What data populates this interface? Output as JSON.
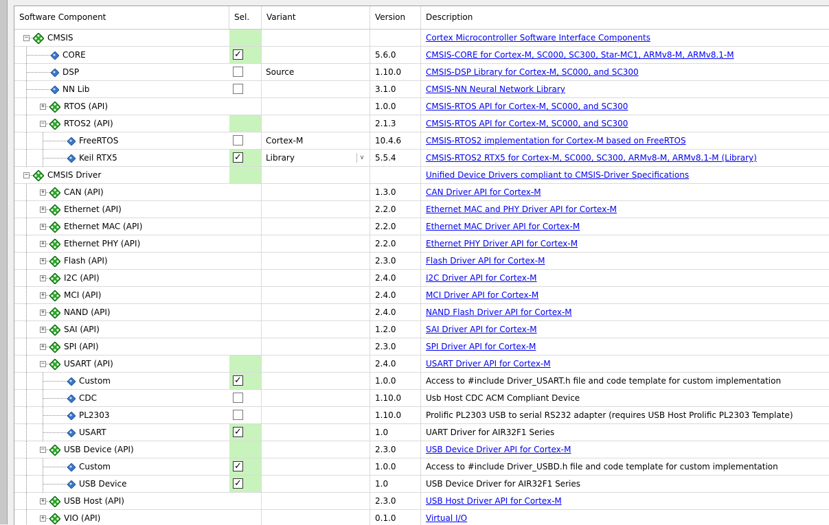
{
  "headers": {
    "component": "Software Component",
    "sel": "Sel.",
    "variant": "Variant",
    "version": "Version",
    "description": "Description"
  },
  "colors": {
    "selected_green": "#c9f3bd",
    "link": "#0000ee",
    "diamond_green": "#2aa52a"
  },
  "rows": [
    {
      "name": "CMSIS",
      "type": "group",
      "level": 0,
      "expander": "minus",
      "sel": "green",
      "variant": "",
      "version": "",
      "desc": "Cortex Microcontroller Software Interface Components",
      "link": true
    },
    {
      "name": "CORE",
      "type": "leaf",
      "level": 1,
      "sel": "checked",
      "variant": "",
      "version": "5.6.0",
      "desc": "CMSIS-CORE for Cortex-M, SC000, SC300, Star-MC1, ARMv8-M, ARMv8.1-M",
      "link": true
    },
    {
      "name": "DSP",
      "type": "leaf",
      "level": 1,
      "sel": "unchecked",
      "variant": "Source",
      "version": "1.10.0",
      "desc": "CMSIS-DSP Library for Cortex-M, SC000, and SC300",
      "link": true
    },
    {
      "name": "NN Lib",
      "type": "leaf",
      "level": 1,
      "sel": "unchecked",
      "variant": "",
      "version": "3.1.0",
      "desc": "CMSIS-NN Neural Network Library",
      "link": true
    },
    {
      "name": "RTOS (API)",
      "type": "group",
      "level": 1,
      "expander": "plus",
      "sel": "",
      "variant": "",
      "version": "1.0.0",
      "desc": "CMSIS-RTOS API for Cortex-M, SC000, and SC300",
      "link": true
    },
    {
      "name": "RTOS2 (API)",
      "type": "group",
      "level": 1,
      "expander": "minus",
      "sel": "green",
      "variant": "",
      "version": "2.1.3",
      "desc": "CMSIS-RTOS API for Cortex-M, SC000, and SC300",
      "link": true
    },
    {
      "name": "FreeRTOS",
      "type": "leaf",
      "level": 2,
      "sel": "unchecked",
      "variant": "Cortex-M",
      "version": "10.4.6",
      "desc": "CMSIS-RTOS2 implementation for Cortex-M based on FreeRTOS",
      "link": true
    },
    {
      "name": "Keil RTX5",
      "type": "leaf",
      "level": 2,
      "sel": "checked",
      "variant": "Library",
      "dropdown": true,
      "version": "5.5.4",
      "desc": "CMSIS-RTOS2 RTX5 for Cortex-M, SC000, SC300, ARMv8-M, ARMv8.1-M (Library)",
      "link": true
    },
    {
      "name": "CMSIS Driver",
      "type": "group",
      "level": 0,
      "expander": "minus",
      "sel": "green",
      "variant": "",
      "version": "",
      "desc": "Unified Device Drivers compliant to CMSIS-Driver Specifications",
      "link": true
    },
    {
      "name": "CAN (API)",
      "type": "group",
      "level": 1,
      "expander": "plus",
      "sel": "",
      "variant": "",
      "version": "1.3.0",
      "desc": "CAN Driver API for Cortex-M",
      "link": true
    },
    {
      "name": "Ethernet (API)",
      "type": "group",
      "level": 1,
      "expander": "plus",
      "sel": "",
      "variant": "",
      "version": "2.2.0",
      "desc": "Ethernet MAC and PHY Driver API for Cortex-M",
      "link": true
    },
    {
      "name": "Ethernet MAC (API)",
      "type": "group",
      "level": 1,
      "expander": "plus",
      "sel": "",
      "variant": "",
      "version": "2.2.0",
      "desc": "Ethernet MAC Driver API for Cortex-M",
      "link": true
    },
    {
      "name": "Ethernet PHY (API)",
      "type": "group",
      "level": 1,
      "expander": "plus",
      "sel": "",
      "variant": "",
      "version": "2.2.0",
      "desc": "Ethernet PHY Driver API for Cortex-M",
      "link": true
    },
    {
      "name": "Flash (API)",
      "type": "group",
      "level": 1,
      "expander": "plus",
      "sel": "",
      "variant": "",
      "version": "2.3.0",
      "desc": "Flash Driver API for Cortex-M",
      "link": true
    },
    {
      "name": "I2C (API)",
      "type": "group",
      "level": 1,
      "expander": "plus",
      "sel": "",
      "variant": "",
      "version": "2.4.0",
      "desc": "I2C Driver API for Cortex-M",
      "link": true
    },
    {
      "name": "MCI (API)",
      "type": "group",
      "level": 1,
      "expander": "plus",
      "sel": "",
      "variant": "",
      "version": "2.4.0",
      "desc": "MCI Driver API for Cortex-M",
      "link": true
    },
    {
      "name": "NAND (API)",
      "type": "group",
      "level": 1,
      "expander": "plus",
      "sel": "",
      "variant": "",
      "version": "2.4.0",
      "desc": "NAND Flash Driver API for Cortex-M",
      "link": true
    },
    {
      "name": "SAI (API)",
      "type": "group",
      "level": 1,
      "expander": "plus",
      "sel": "",
      "variant": "",
      "version": "1.2.0",
      "desc": "SAI Driver API for Cortex-M",
      "link": true
    },
    {
      "name": "SPI (API)",
      "type": "group",
      "level": 1,
      "expander": "plus",
      "sel": "",
      "variant": "",
      "version": "2.3.0",
      "desc": "SPI Driver API for Cortex-M",
      "link": true
    },
    {
      "name": "USART (API)",
      "type": "group",
      "level": 1,
      "expander": "minus",
      "sel": "green",
      "variant": "",
      "version": "2.4.0",
      "desc": "USART Driver API for Cortex-M",
      "link": true
    },
    {
      "name": "Custom",
      "type": "leaf",
      "level": 2,
      "sel": "checked",
      "variant": "",
      "version": "1.0.0",
      "desc": "Access to #include Driver_USART.h file and code template for custom implementation",
      "link": false
    },
    {
      "name": "CDC",
      "type": "leaf",
      "level": 2,
      "sel": "unchecked",
      "variant": "",
      "version": "1.10.0",
      "desc": "Usb Host CDC ACM Compliant Device",
      "link": false
    },
    {
      "name": "PL2303",
      "type": "leaf",
      "level": 2,
      "sel": "unchecked",
      "variant": "",
      "version": "1.10.0",
      "desc": "Prolific PL2303 USB to serial RS232 adapter (requires USB Host Prolific PL2303 Template)",
      "link": false
    },
    {
      "name": "USART",
      "type": "leaf",
      "level": 2,
      "sel": "checked",
      "variant": "",
      "version": "1.0",
      "desc": "UART Driver for AIR32F1 Series",
      "link": false
    },
    {
      "name": "USB Device (API)",
      "type": "group",
      "level": 1,
      "expander": "minus",
      "sel": "green",
      "variant": "",
      "version": "2.3.0",
      "desc": "USB Device Driver API for Cortex-M",
      "link": true
    },
    {
      "name": "Custom",
      "type": "leaf",
      "level": 2,
      "sel": "checked",
      "variant": "",
      "version": "1.0.0",
      "desc": "Access to #include Driver_USBD.h file and code template for custom implementation",
      "link": false
    },
    {
      "name": "USB Device",
      "type": "leaf",
      "level": 2,
      "sel": "checked",
      "variant": "",
      "version": "1.0",
      "desc": "USB Device Driver for AIR32F1 Series",
      "link": false
    },
    {
      "name": "USB Host (API)",
      "type": "group",
      "level": 1,
      "expander": "plus",
      "sel": "",
      "variant": "",
      "version": "2.3.0",
      "desc": "USB Host Driver API for Cortex-M",
      "link": true
    },
    {
      "name": "VIO (API)",
      "type": "group",
      "level": 1,
      "expander": "plus",
      "sel": "",
      "variant": "",
      "version": "0.1.0",
      "desc": "Virtual I/O",
      "link": true
    }
  ]
}
